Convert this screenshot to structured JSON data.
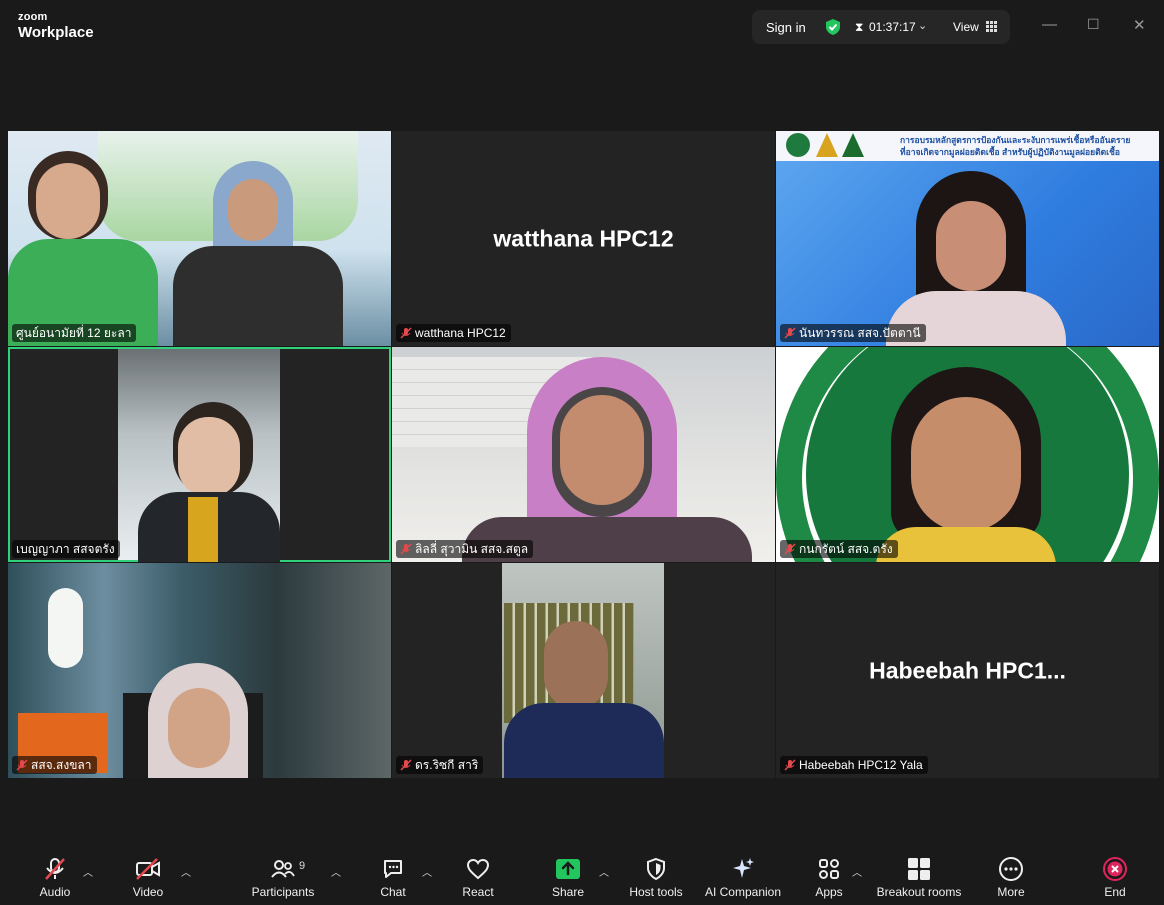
{
  "app": {
    "brand_top": "zoom",
    "brand_bottom": "Workplace"
  },
  "header": {
    "sign_in": "Sign in",
    "timer": "01:37:17",
    "view": "View"
  },
  "tiles": [
    {
      "name": "ศูนย์อนามัยที่ 12 ยะลา",
      "muted": false
    },
    {
      "name": "watthana HPC12",
      "muted": true,
      "display_name": "watthana HPC12"
    },
    {
      "name": "นันทวรรณ  สสจ.ปัตตานี",
      "muted": true,
      "banner_1": "การอบรมหลักสูตรการป้องกันและระงับการแพร่เชื้อหรืออันตราย",
      "banner_2": "ที่อาจเกิดจากมูลฝอยติดเชื้อ สำหรับผู้ปฏิบัติงานมูลฝอยติดเชื้อ"
    },
    {
      "name": "เบญญาภา สสจตรัง",
      "muted": false
    },
    {
      "name": "ลิลลี่ สุวามิน สสจ.สตูล",
      "muted": true
    },
    {
      "name": "กนกรัตน์ สสจ.ตรัง",
      "muted": true
    },
    {
      "name": "สสจ.สงขลา",
      "muted": true
    },
    {
      "name": "ดร.ริซกี สาริ",
      "muted": true
    },
    {
      "name": "Habeebah HPC12 Yala",
      "muted": true,
      "display_name": "Habeebah  HPC1..."
    }
  ],
  "toolbar": {
    "audio": "Audio",
    "video": "Video",
    "participants": "Participants",
    "participants_count": "9",
    "chat": "Chat",
    "react": "React",
    "share": "Share",
    "host_tools": "Host tools",
    "ai_companion": "AI Companion",
    "apps": "Apps",
    "breakout_rooms": "Breakout rooms",
    "more": "More",
    "end": "End"
  },
  "colors": {
    "accent_green": "#2fd27b",
    "share_green": "#23c55e",
    "end_red": "#e0245e",
    "muted_red": "#e5484d"
  }
}
